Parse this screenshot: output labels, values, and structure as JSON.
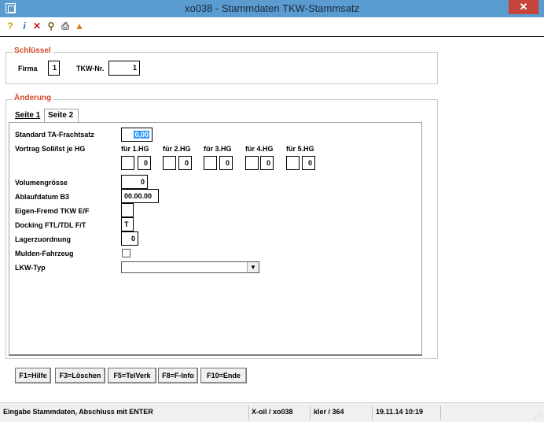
{
  "window": {
    "title": "xo038 - Stammdaten TKW-Stammsatz",
    "close_glyph": "✕"
  },
  "toolbar": {
    "icons": [
      "help-icon",
      "info-icon",
      "delete-icon",
      "binoculars-icon",
      "print-icon",
      "export-icon"
    ],
    "glyphs": [
      "?",
      "i",
      "✕",
      "⚲",
      "⎙",
      "▲"
    ]
  },
  "schluessel": {
    "legend": "Schlüssel",
    "firma_label": "Firma",
    "firma_value": "1",
    "tkw_label": "TKW-Nr.",
    "tkw_value": "1"
  },
  "aenderung": {
    "legend": "Änderung",
    "tabs": [
      {
        "label": "Seite 1",
        "active": false
      },
      {
        "label": "Seite 2",
        "active": true
      }
    ],
    "standard_label": "Standard TA-Frachtsatz",
    "standard_value": "0,00",
    "vortrag_label": "Vortrag Soll/Ist je HG",
    "hg_headers": [
      "für 1.HG",
      "für 2.HG",
      "für 3.HG",
      "für 4.HG",
      "für 5.HG"
    ],
    "hg_values": [
      "0",
      "0",
      "0",
      "0",
      "0"
    ],
    "volumen_label": "Volumengrösse",
    "volumen_value": "0",
    "ablauf_label": "Ablaufdatum B3",
    "ablauf_value": "00.00.00",
    "eigen_label": "Eigen-Fremd TKW E/F",
    "eigen_value": "",
    "docking_label": "Docking FTL/TDL F/T",
    "docking_value": "T",
    "lager_label": "Lagerzuordnung",
    "lager_value": "0",
    "mulden_label": "Mulden-Fahrzeug",
    "lkw_label": "LKW-Typ",
    "lkw_value": ""
  },
  "fbuttons": [
    "F1=Hilfe",
    "F3=Löschen",
    "F5=TelVerk",
    "F8=F-Info",
    "F10=Ende"
  ],
  "status": {
    "message": "Eingabe Stammdaten, Abschluss mit ENTER",
    "program": "X-oil / xo038",
    "user": "kler / 364",
    "datetime": "19.11.14 10:19"
  },
  "colors": {
    "titlebar": "#5a9bd0",
    "close": "#c7443a",
    "legend": "#d24a2a",
    "selection": "#3399ff"
  }
}
